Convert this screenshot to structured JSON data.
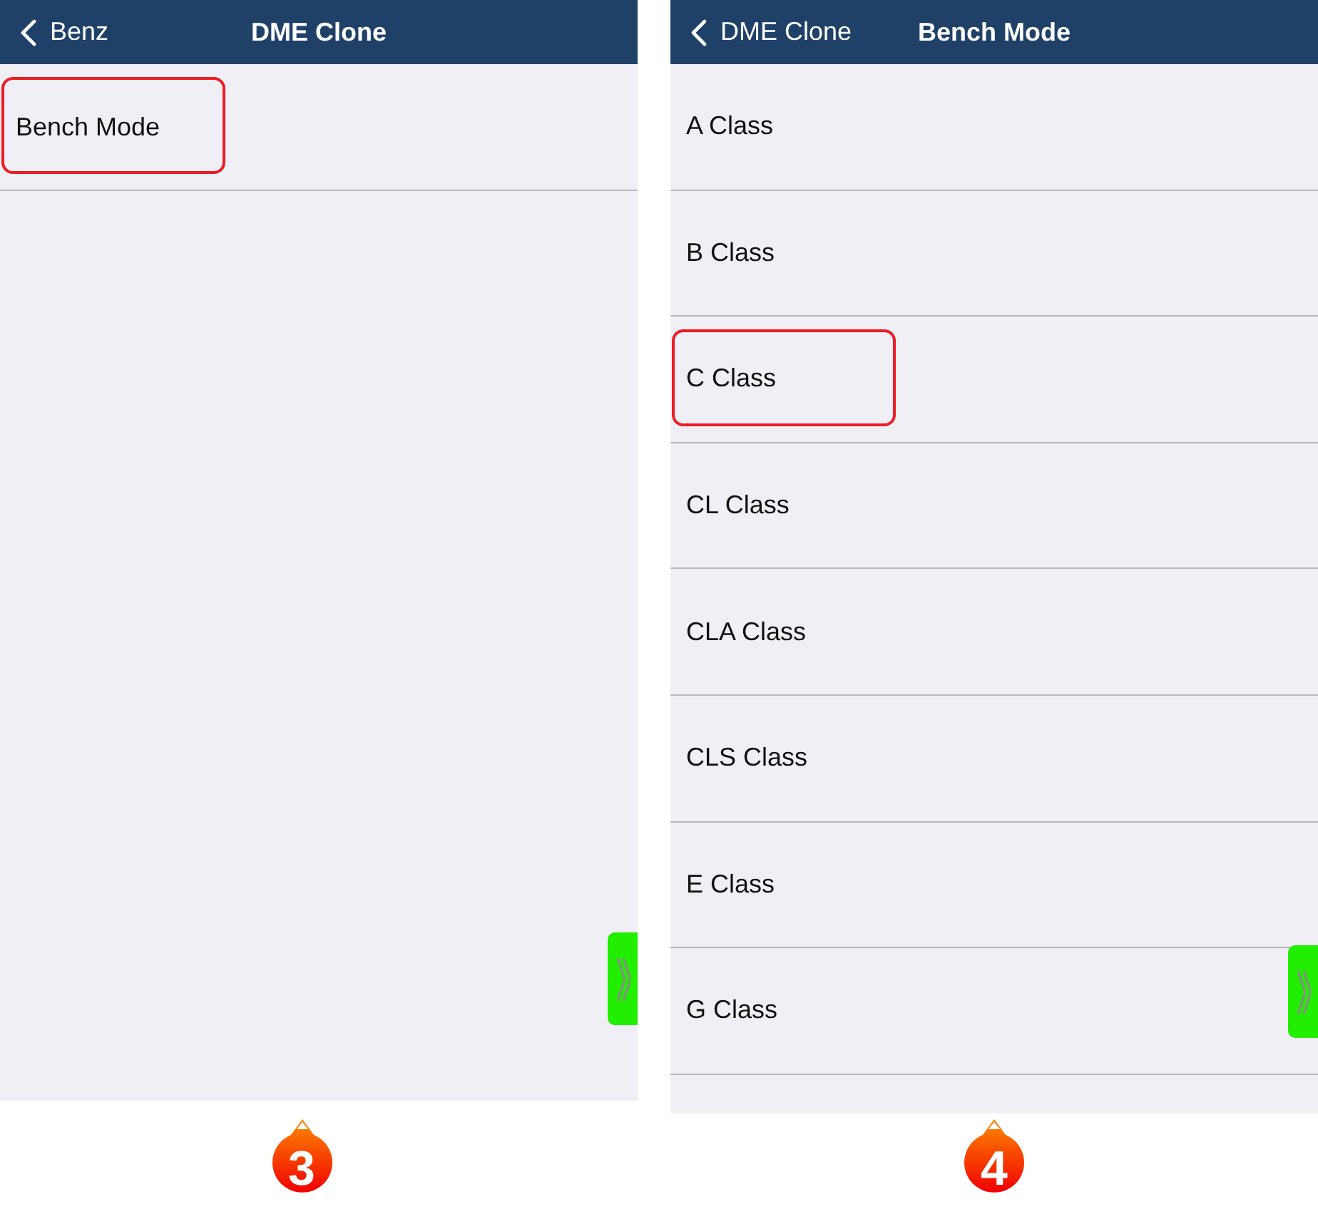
{
  "panels": [
    {
      "nav": {
        "back_label": "Benz",
        "title": "DME Clone"
      },
      "items": [
        {
          "label": "Bench Mode",
          "highlighted": true
        }
      ],
      "step": "3"
    },
    {
      "nav": {
        "back_label": "DME Clone",
        "title": "Bench Mode"
      },
      "items": [
        {
          "label": "A Class",
          "highlighted": false
        },
        {
          "label": "B Class",
          "highlighted": false
        },
        {
          "label": "C Class",
          "highlighted": true
        },
        {
          "label": "CL Class",
          "highlighted": false
        },
        {
          "label": "CLA Class",
          "highlighted": false
        },
        {
          "label": "CLS Class",
          "highlighted": false
        },
        {
          "label": "E Class",
          "highlighted": false
        },
        {
          "label": "G Class",
          "highlighted": false
        }
      ],
      "step": "4"
    }
  ]
}
